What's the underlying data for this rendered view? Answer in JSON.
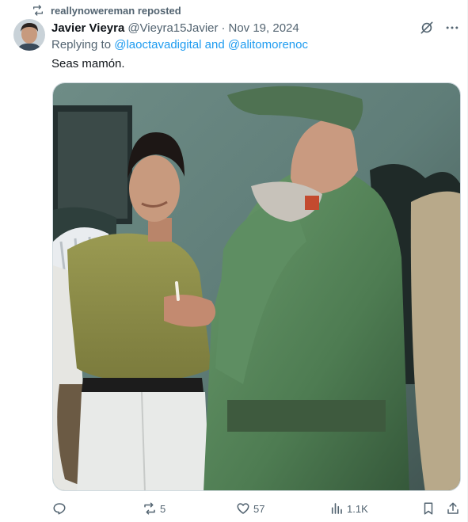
{
  "repost_banner": {
    "text": "reallynowereman reposted",
    "icon": "repost-icon"
  },
  "author": {
    "name": "Javier Vieyra",
    "handle": "@Vieyra15Javier",
    "separator": "·",
    "date": "Nov 19, 2024"
  },
  "replying": {
    "prefix": "Replying to ",
    "mentions": "@laoctavadigital and @alitomorenoc"
  },
  "tweet": {
    "text": "Seas mamón."
  },
  "top_icons": [
    "grok-icon",
    "more-icon"
  ],
  "actions": {
    "reply": {
      "icon": "reply-icon",
      "count": ""
    },
    "repost": {
      "icon": "repost-icon",
      "count": "5"
    },
    "like": {
      "icon": "heart-icon",
      "count": "57"
    },
    "views": {
      "icon": "views-icon",
      "count": "1.1K"
    },
    "bookmark": {
      "icon": "bookmark-icon",
      "count": ""
    },
    "share": {
      "icon": "share-icon",
      "count": ""
    }
  },
  "colors": {
    "text_primary": "#0f1419",
    "text_secondary": "#536471",
    "accent": "#1d9bf0",
    "border": "#cfd9de"
  }
}
